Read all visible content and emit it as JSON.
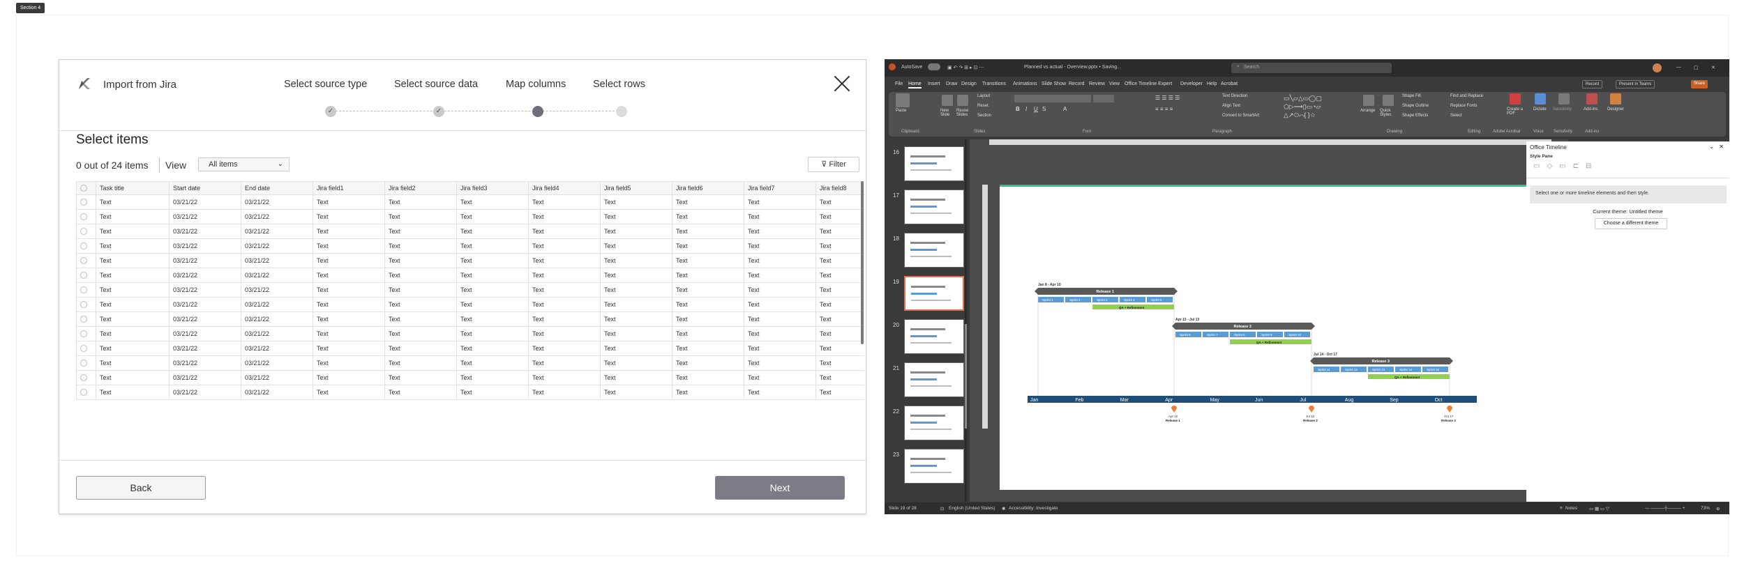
{
  "section_tag": "Section 4",
  "dialog": {
    "title": "Import from Jira",
    "steps": [
      {
        "label": "Select source type",
        "state": "done"
      },
      {
        "label": "Select source data",
        "state": "done"
      },
      {
        "label": "Map columns",
        "state": "active"
      },
      {
        "label": "Select rows",
        "state": "todo"
      }
    ],
    "section_title": "Select items",
    "count_text": "0 out of 24 items",
    "view_label": "View",
    "view_selected": "All items",
    "filter_label": "Filter",
    "table": {
      "headers": [
        "Task title",
        "Start date",
        "End date",
        "Jira field1",
        "Jira field2",
        "Jira field3",
        "Jira field4",
        "Jira field5",
        "Jira field6",
        "Jira field7",
        "Jira field8"
      ],
      "rows": [
        [
          "Text",
          "03/21/22",
          "03/21/22",
          "Text",
          "Text",
          "Text",
          "Text",
          "Text",
          "Text",
          "Text",
          "Text"
        ],
        [
          "Text",
          "03/21/22",
          "03/21/22",
          "Text",
          "Text",
          "Text",
          "Text",
          "Text",
          "Text",
          "Text",
          "Text"
        ],
        [
          "Text",
          "03/21/22",
          "03/21/22",
          "Text",
          "Text",
          "Text",
          "Text",
          "Text",
          "Text",
          "Text",
          "Text"
        ],
        [
          "Text",
          "03/21/22",
          "03/21/22",
          "Text",
          "Text",
          "Text",
          "Text",
          "Text",
          "Text",
          "Text",
          "Text"
        ],
        [
          "Text",
          "03/21/22",
          "03/21/22",
          "Text",
          "Text",
          "Text",
          "Text",
          "Text",
          "Text",
          "Text",
          "Text"
        ],
        [
          "Text",
          "03/21/22",
          "03/21/22",
          "Text",
          "Text",
          "Text",
          "Text",
          "Text",
          "Text",
          "Text",
          "Text"
        ],
        [
          "Text",
          "03/21/22",
          "03/21/22",
          "Text",
          "Text",
          "Text",
          "Text",
          "Text",
          "Text",
          "Text",
          "Text"
        ],
        [
          "Text",
          "03/21/22",
          "03/21/22",
          "Text",
          "Text",
          "Text",
          "Text",
          "Text",
          "Text",
          "Text",
          "Text"
        ],
        [
          "Text",
          "03/21/22",
          "03/21/22",
          "Text",
          "Text",
          "Text",
          "Text",
          "Text",
          "Text",
          "Text",
          "Text"
        ],
        [
          "Text",
          "03/21/22",
          "03/21/22",
          "Text",
          "Text",
          "Text",
          "Text",
          "Text",
          "Text",
          "Text",
          "Text"
        ],
        [
          "Text",
          "03/21/22",
          "03/21/22",
          "Text",
          "Text",
          "Text",
          "Text",
          "Text",
          "Text",
          "Text",
          "Text"
        ],
        [
          "Text",
          "03/21/22",
          "03/21/22",
          "Text",
          "Text",
          "Text",
          "Text",
          "Text",
          "Text",
          "Text",
          "Text"
        ],
        [
          "Text",
          "03/21/22",
          "03/21/22",
          "Text",
          "Text",
          "Text",
          "Text",
          "Text",
          "Text",
          "Text",
          "Text"
        ],
        [
          "Text",
          "03/21/22",
          "03/21/22",
          "Text",
          "Text",
          "Text",
          "Text",
          "Text",
          "Text",
          "Text",
          "Text"
        ]
      ]
    },
    "back_label": "Back",
    "next_label": "Next"
  },
  "ppt": {
    "autosave": "AutoSave",
    "filename": "Planned vs actual - Overview.pptx • Saving...",
    "search_placeholder": "Search",
    "menu": [
      "File",
      "Home",
      "Insert",
      "Draw",
      "Design",
      "Transitions",
      "Animations",
      "Slide Show",
      "Record",
      "Review",
      "View",
      "Office Timeline Expert",
      "Developer",
      "Help",
      "Acrobat"
    ],
    "record_label": "Record",
    "present_label": "Present in Teams",
    "share_label": "Share",
    "ribbon_groups": [
      "Clipboard",
      "Slides",
      "Font",
      "Paragraph",
      "Drawing",
      "Editing",
      "Adobe Acrobat",
      "Voice",
      "Sensitivity",
      "Add-ins"
    ],
    "ribbon_buttons": {
      "paste": "Paste",
      "new_slide": "New Slide",
      "reuse": "Reuse Slides",
      "layout": "Layout",
      "reset": "Reset",
      "section": "Section",
      "text_direction": "Text Direction",
      "align_text": "Align Text",
      "smartart": "Convert to SmartArt",
      "arrange": "Arrange",
      "quick_styles": "Quick Styles",
      "shape_fill": "Shape Fill",
      "shape_outline": "Shape Outline",
      "shape_effects": "Shape Effects",
      "find_replace": "Find and Replace",
      "replace_fonts": "Replace Fonts",
      "select": "Select",
      "create_pdf": "Create a PDF",
      "dictate": "Dictate",
      "sensitivity": "Sensitivity",
      "addins": "Add-ins",
      "designer": "Designer"
    },
    "thumb_numbers": [
      "16",
      "17",
      "18",
      "19",
      "20",
      "21",
      "22",
      "23"
    ],
    "selected_thumb": "19",
    "timeline": {
      "months": [
        "Jan",
        "Feb",
        "Mar",
        "Apr",
        "May",
        "Jun",
        "Jul",
        "Aug",
        "Sep",
        "Oct"
      ],
      "releases": [
        {
          "range": "Jan 8 - Apr 10",
          "name": "Release 1",
          "sprints": [
            "Sprint 1",
            "Sprint 2",
            "Sprint 3",
            "Sprint 4",
            "Sprint 5"
          ],
          "bar": "QA + Refinement",
          "milestone_date": "Apr 10",
          "milestone_name": "Release 1"
        },
        {
          "range": "Apr 13 - Jul 13",
          "name": "Release 2",
          "sprints": [
            "Sprint 6",
            "Sprint 7",
            "Sprint 8",
            "Sprint 9",
            "Sprint 10"
          ],
          "bar": "QA + Refinement",
          "milestone_date": "Jul 13",
          "milestone_name": "Release 2"
        },
        {
          "range": "Jul 14 - Oct 17",
          "name": "Release 3",
          "sprints": [
            "Sprint 11",
            "Sprint 12",
            "Sprint 13",
            "Sprint 14",
            "Sprint 15"
          ],
          "bar": "QA + Refinement",
          "milestone_date": "Oct 17",
          "milestone_name": "Release 3"
        }
      ]
    },
    "pane": {
      "title": "Office Timeline",
      "subtitle": "Style Pane",
      "message": "Select one or more timeline elements and then style.",
      "current_theme": "Current theme: Untitled theme",
      "choose_theme": "Choose a different theme"
    },
    "status": {
      "slide": "Slide 19 of 28",
      "language": "English (United States)",
      "accessibility": "Accessibility: Investigate",
      "notes": "Notes",
      "zoom": "73%"
    },
    "colors": {
      "accent": "#c8602a",
      "sprint": "#5b9bd5",
      "qa": "#92d050",
      "release": "#595959",
      "axis": "#1f4e79",
      "milestone": "#ed7d31"
    }
  }
}
